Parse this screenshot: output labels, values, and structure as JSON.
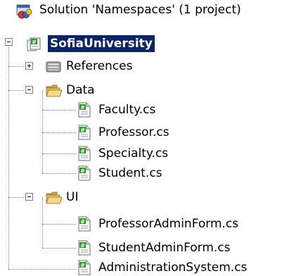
{
  "solution_explorer": {
    "solution_label": "Solution 'Namespaces' (1 project)",
    "project_label": "SofiaUniversity",
    "references_label": "References",
    "data_folder_label": "Data",
    "data_files": [
      "Faculty.cs",
      "Professor.cs",
      "Specialty.cs",
      "Student.cs"
    ],
    "ui_folder_label": "UI",
    "ui_files": [
      "ProfessorAdminForm.cs",
      "StudentAdminForm.cs"
    ],
    "root_file": "AdministrationSystem.cs",
    "icons": {
      "solution": "solution-icon",
      "project": "csharp-project-icon",
      "references": "references-icon",
      "folder": "folder-open-icon",
      "file": "csharp-file-icon"
    },
    "colors": {
      "selection": "#0a246a",
      "selection_text": "#ffffff",
      "folder": "#f3d37a",
      "file_accent": "#1e9e1e"
    }
  }
}
